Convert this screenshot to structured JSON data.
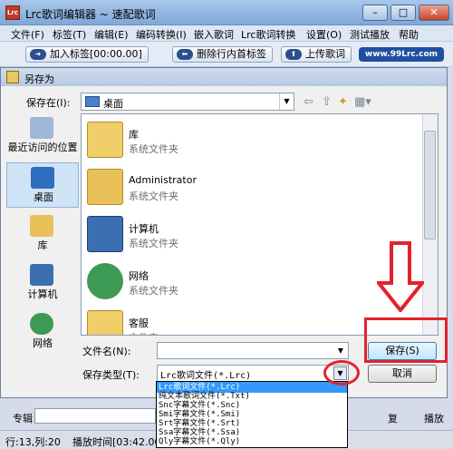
{
  "app": {
    "title": "Lrc歌词编辑器 ~ 速配歌词",
    "logo_text": "Lrc",
    "menu": [
      "文件(F)",
      "标签(T)",
      "编辑(E)",
      "编码转换(I)",
      "嵌入歌词",
      "Lrc歌词转换",
      "设置(O)",
      "测试播放",
      "帮助"
    ],
    "toolbar": {
      "add_tag": "加入标签[00:00.00]",
      "delete_tag": "删除行内首标签",
      "upload": "上传歌词"
    },
    "website": "www.99Lrc.com",
    "album_label": "专辑",
    "status_pos": "行:13,列:20",
    "status_time": "播放时间[03:42.00]",
    "status_right1": "复",
    "status_right2": "播放",
    "colors": {
      "accent_red": "#e3222c",
      "selection": "#3399ff",
      "title_bar": "#b6c9e2"
    }
  },
  "dialog": {
    "title": "另存为",
    "save_in_label": "保存在(I):",
    "save_in_value": "桌面",
    "places": [
      {
        "label": "最近访问的位置",
        "icon": "recent-icon"
      },
      {
        "label": "桌面",
        "icon": "desktop-icon"
      },
      {
        "label": "库",
        "icon": "library-icon"
      },
      {
        "label": "计算机",
        "icon": "computer-icon"
      },
      {
        "label": "网络",
        "icon": "network-icon"
      }
    ],
    "files": [
      {
        "name": "库",
        "type": "系统文件夹",
        "icon": "library-folder-icon"
      },
      {
        "name": "Administrator",
        "type": "系统文件夹",
        "icon": "user-folder-icon"
      },
      {
        "name": "计算机",
        "type": "系统文件夹",
        "icon": "computer-icon"
      },
      {
        "name": "网络",
        "type": "系统文件夹",
        "icon": "network-icon"
      },
      {
        "name": "客服",
        "type": "文件夹",
        "icon": "folder-icon"
      }
    ],
    "filename_label": "文件名(N):",
    "filename_value": "",
    "filetype_label": "保存类型(T):",
    "filetype_value": "Lrc歌词文件(*.Lrc)",
    "save_button": "保存(S)",
    "cancel_button": "取消",
    "filetype_options": [
      "Lrc歌词文件(*.Lrc)",
      "纯文本歌词文件(*.Txt)",
      "Snc字幕文件(*.Snc)",
      "Smi字幕文件(*.Smi)",
      "Srt字幕文件(*.Srt)",
      "Ssa字幕文件(*.Ssa)",
      "Qly字幕文件(*.Qly)"
    ]
  }
}
